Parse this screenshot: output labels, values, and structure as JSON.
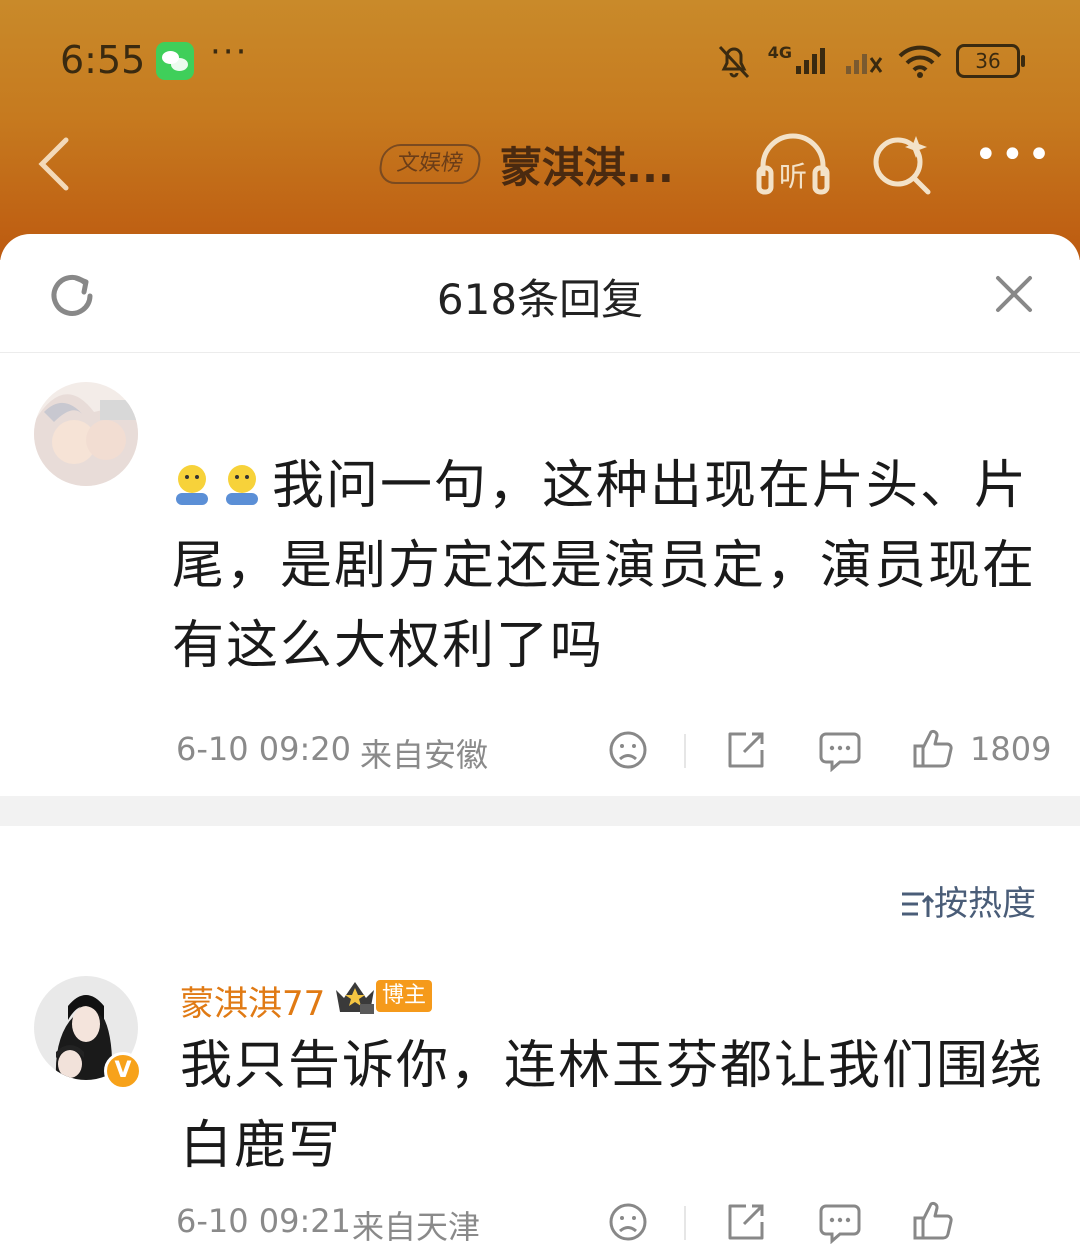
{
  "status_bar": {
    "time": "6:55",
    "more": "···",
    "network": "4G",
    "battery": "36"
  },
  "nav": {
    "tag": "文娱榜",
    "title": "蒙淇淇...",
    "listen_label": "听"
  },
  "sheet": {
    "title": "618条回复"
  },
  "post": {
    "text": "我问一句，这种出现在片头、片尾，是剧方定还是演员定，演员现在有这么大权利了吗",
    "date": "6-10 09:20",
    "location": "来自安徽",
    "likes": "1809"
  },
  "sort": {
    "label": "按热度"
  },
  "reply": {
    "username": "蒙淇淇77",
    "badge": "博主",
    "text": "我只告诉你，连林玉芬都让我们围绕白鹿写",
    "date": "6-10 09:21",
    "location": "来自天津"
  },
  "colors": {
    "accent": "#e07a14",
    "header_bg": "#c67a1f"
  }
}
